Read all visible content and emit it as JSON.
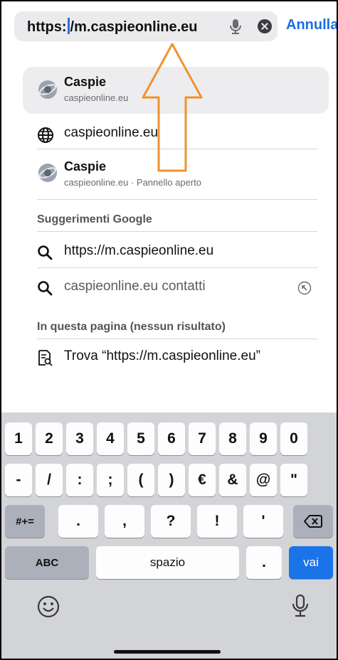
{
  "address_bar": {
    "url_before_caret": "https:",
    "url_after_caret": "/m.caspieonline.eu",
    "cancel_label": "Annulla"
  },
  "suggestions": [
    {
      "title": "Caspie",
      "subtitle": "caspieonline.eu",
      "icon": "caspie-favicon-icon",
      "selected": true
    },
    {
      "title": "caspieonline.eu",
      "icon": "globe-icon"
    },
    {
      "title": "Caspie",
      "subtitle": "caspieonline.eu · Pannello aperto",
      "icon": "caspie-favicon-icon"
    }
  ],
  "google_section": {
    "header": "Suggerimenti Google",
    "items": [
      {
        "text": "https://m.caspieonline.eu",
        "icon": "search-icon"
      },
      {
        "text": "caspieonline.eu contatti",
        "icon": "search-icon",
        "trailing_icon": "fill-arrow-icon"
      }
    ]
  },
  "page_section": {
    "header": "In questa pagina (nessun risultato)",
    "find_label": "Trova “https://m.caspieonline.eu”",
    "icon": "find-in-page-icon"
  },
  "keyboard": {
    "row1": [
      "1",
      "2",
      "3",
      "4",
      "5",
      "6",
      "7",
      "8",
      "9",
      "0"
    ],
    "row2": [
      "-",
      "/",
      ":",
      ";",
      "(",
      ")",
      "€",
      "&",
      "@",
      "\""
    ],
    "row3_mode": "#+=",
    "row3": [
      ".",
      ",",
      "?",
      "!",
      "'"
    ],
    "backspace_icon": "backspace-icon",
    "abc_label": "ABC",
    "space_label": "spazio",
    "period_label": ".",
    "go_label": "vai",
    "emoji_icon": "emoji-icon",
    "dictation_icon": "microphone-icon"
  },
  "annotation": {
    "icon": "up-arrow-annotation",
    "color": "#f0922e"
  },
  "colors": {
    "accent": "#1a6ee6",
    "go_key": "#1a74e8",
    "keyboard_bg": "#d3d4d8"
  }
}
